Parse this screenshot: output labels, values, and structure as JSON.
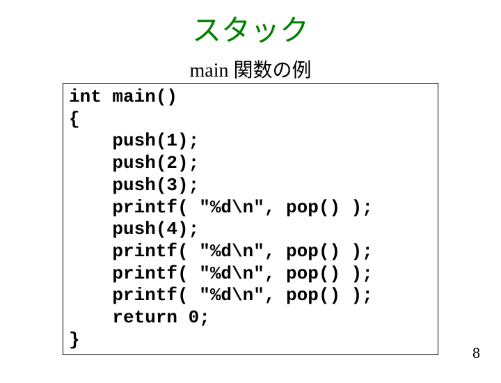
{
  "title": "スタック",
  "subtitle": "main 関数の例",
  "code": "int main()\n{\n    push(1);\n    push(2);\n    push(3);\n    printf( \"%d\\n\", pop() );\n    push(4);\n    printf( \"%d\\n\", pop() );\n    printf( \"%d\\n\", pop() );\n    printf( \"%d\\n\", pop() );\n    return 0;\n}",
  "page_number": "8"
}
